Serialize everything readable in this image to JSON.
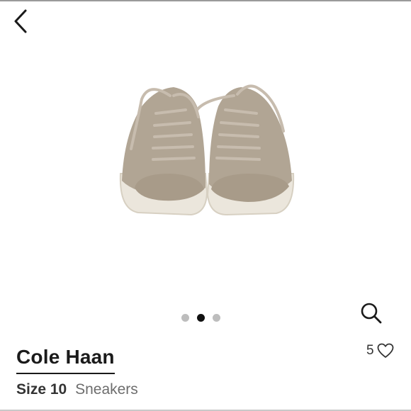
{
  "header": {
    "back_icon": "chevron-left-icon"
  },
  "gallery": {
    "image_subject": "pair of beige suede low-top sneakers",
    "dots": [
      {
        "active": false
      },
      {
        "active": true
      },
      {
        "active": false
      }
    ],
    "zoom_icon": "search-icon"
  },
  "product": {
    "brand": "Cole Haan",
    "size_label": "Size",
    "size_value": "10",
    "category": "Sneakers",
    "likes_count": "5",
    "like_icon": "heart-icon"
  }
}
